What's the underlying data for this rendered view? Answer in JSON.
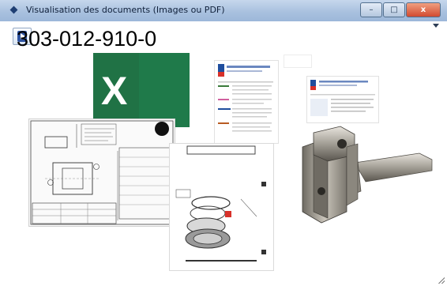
{
  "window": {
    "title": "Visualisation des documents (Images ou PDF)",
    "buttons": {
      "minimize": "–",
      "maximize": "□",
      "close": "x"
    }
  },
  "toolbar": {
    "exit_icon": "exit-door-icon",
    "menu_icon": "dropdown-arrow-icon"
  },
  "document": {
    "number": "303-012-910-0"
  },
  "thumbnails": [
    {
      "kind": "excel-file",
      "icon": "excel-icon"
    },
    {
      "kind": "pdf-document"
    },
    {
      "kind": "blank-preview"
    },
    {
      "kind": "pdf-document"
    },
    {
      "kind": "technical-drawing"
    },
    {
      "kind": "exploded-view-pdf"
    },
    {
      "kind": "photo-machined-shaft"
    }
  ],
  "colors": {
    "excel_green": "#207245",
    "title_bar": "#b9cde5",
    "pdf_accent": "#1f4e9e"
  }
}
